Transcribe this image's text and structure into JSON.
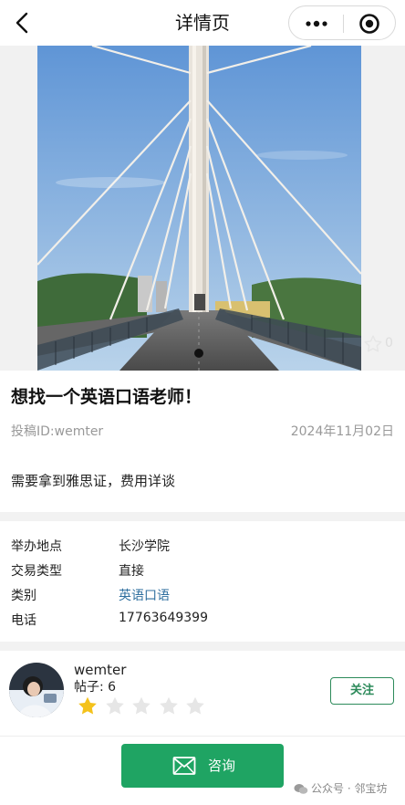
{
  "nav": {
    "title": "详情页"
  },
  "banner": {
    "image_subject": "cable-stayed bridge walkway",
    "favorite_count": "0",
    "active_dot": "1"
  },
  "post": {
    "title": "想找一个英语口语老师！",
    "poster_id_text": "投稿ID:wemter",
    "date": "2024年11月02日",
    "description": "需要拿到雅思证，费用详谈"
  },
  "details": [
    {
      "label": "举办地点",
      "value": "长沙学院"
    },
    {
      "label": "交易类型",
      "value": "直接"
    },
    {
      "label": "类别",
      "value": "英语口语"
    },
    {
      "label": "电话",
      "value": "17763649399"
    }
  ],
  "author": {
    "name": "wemter",
    "posts_text": "帖子: 6",
    "rating": 1,
    "rating_max": 5,
    "follow_label": "关注"
  },
  "actions": {
    "consult_label": "咨询"
  },
  "watermark": {
    "text": "公众号 · 邻宝坊"
  },
  "colors": {
    "accent_green": "#1fa463",
    "follow_green": "#2c8a5a",
    "link_blue": "#2f6f9f",
    "star_gold": "#f4c21b"
  }
}
